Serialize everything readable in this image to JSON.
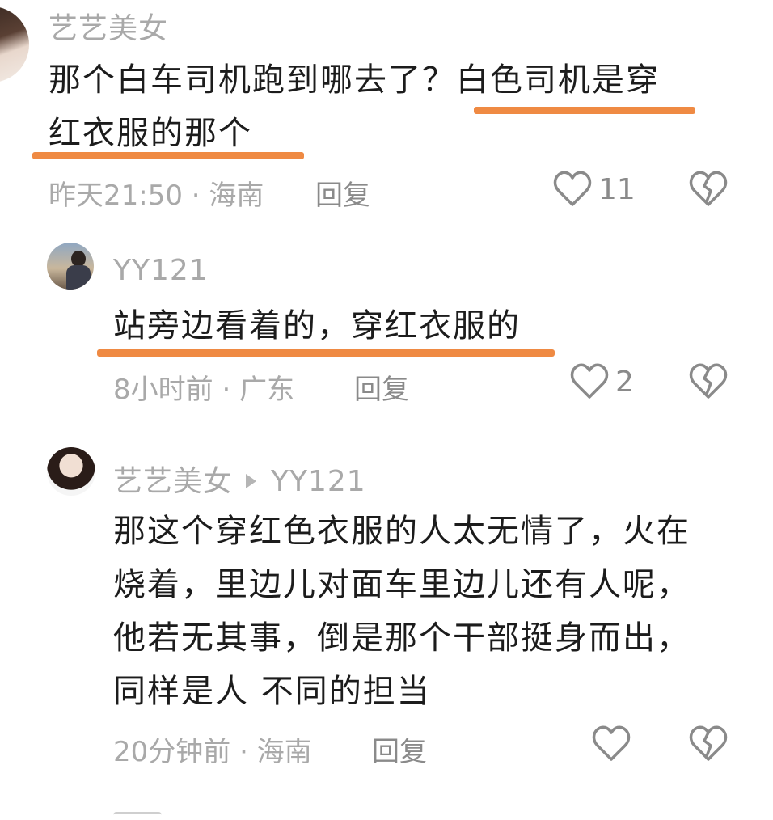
{
  "accent": "#ef8a43",
  "comments": [
    {
      "username": "艺艺美女",
      "lines": [
        "那个白车司机跑到哪去了？白色司机是穿",
        "红衣服的那个"
      ],
      "time": "昨天21:50",
      "location": "海南",
      "reply_label": "回复",
      "likes": "11"
    },
    {
      "username": "YY121",
      "lines": [
        "站旁边看着的，穿红衣服的"
      ],
      "time": "8小时前",
      "location": "广东",
      "reply_label": "回复",
      "likes": "2"
    },
    {
      "username": "艺艺美女",
      "reply_to": "YY121",
      "lines": [
        "那这个穿红色衣服的人太无情了，火在",
        "烧着，里边儿对面车里边儿还有人呢，",
        "他若无其事，倒是那个干部挺身而出，",
        "同样是人 不同的担当"
      ],
      "time": "20分钟前",
      "location": "海南",
      "reply_label": "回复",
      "likes": ""
    }
  ],
  "icons": {
    "like": "heart-outline-icon",
    "dislike": "broken-heart-icon"
  }
}
